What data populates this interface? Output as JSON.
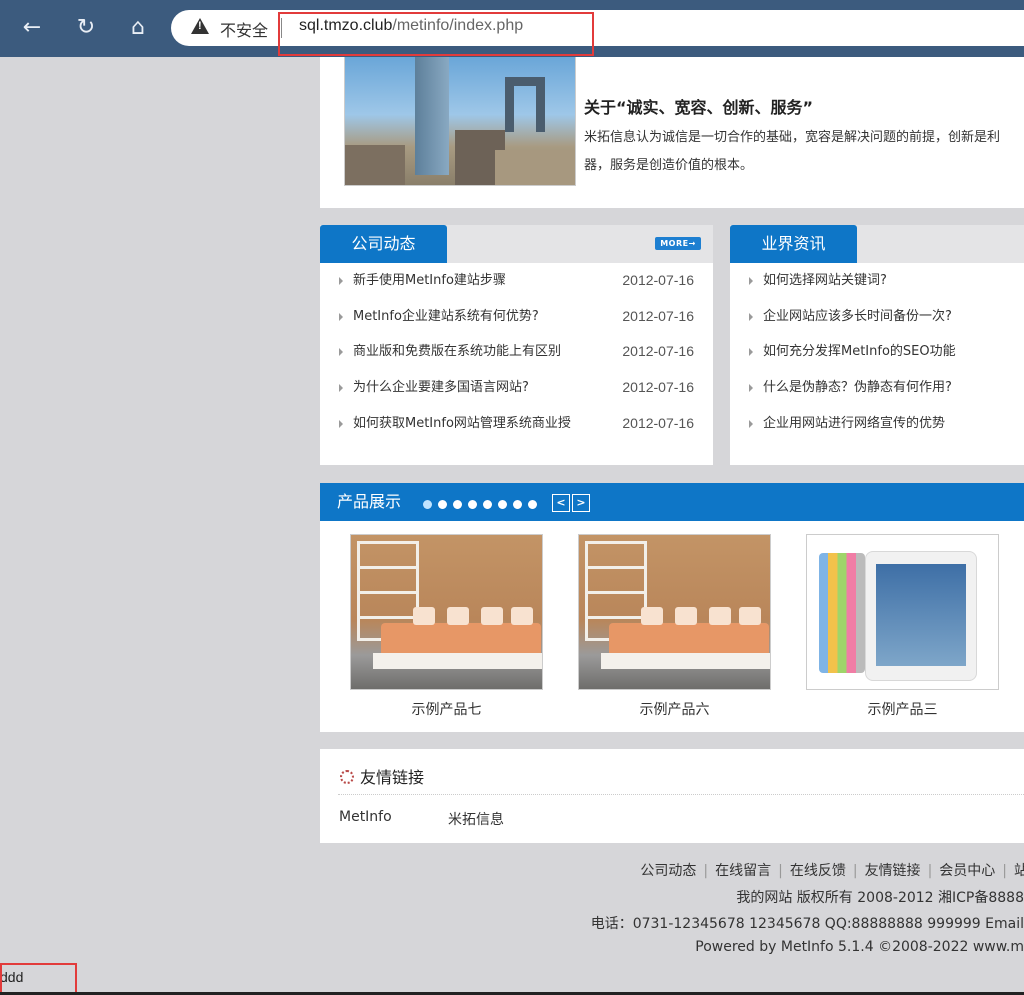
{
  "browser": {
    "back_icon": "←",
    "reload_icon": "↻",
    "home_icon": "⌂",
    "security_label": "不安全",
    "url_host": "sql.tmzo.club",
    "url_path": "/metinfo/index.php"
  },
  "about": {
    "title": "关于“诚实、宽容、创新、服务”",
    "text": "米拓信息认为诚信是一切合作的基础，宽容是解决问题的前提，创新是利器，服务是创造价值的根本。"
  },
  "company_news": {
    "tab_label": "公司动态",
    "more_label": "MORE→",
    "items": [
      {
        "title": "新手使用MetInfo建站步骤",
        "date": "2012-07-16"
      },
      {
        "title": "MetInfo企业建站系统有何优势?",
        "date": "2012-07-16"
      },
      {
        "title": "商业版和免费版在系统功能上有区别",
        "date": "2012-07-16"
      },
      {
        "title": "为什么企业要建多国语言网站?",
        "date": "2012-07-16"
      },
      {
        "title": "如何获取MetInfo网站管理系统商业授",
        "date": "2012-07-16"
      }
    ]
  },
  "industry_news": {
    "tab_label": "业界资讯",
    "items": [
      {
        "title": "如何选择网站关键词?"
      },
      {
        "title": "企业网站应该多长时间备份一次?"
      },
      {
        "title": "如何充分发挥MetInfo的SEO功能"
      },
      {
        "title": "什么是伪静态？伪静态有何作用?"
      },
      {
        "title": "企业用网站进行网络宣传的优势"
      }
    ]
  },
  "products": {
    "title": "产品展示",
    "prev_label": "<",
    "next_label": ">",
    "items": [
      {
        "label": "示例产品七"
      },
      {
        "label": "示例产品六"
      },
      {
        "label": "示例产品三"
      }
    ]
  },
  "friend_links": {
    "title": "友情链接",
    "links": [
      "MetInfo",
      "米拓信息"
    ]
  },
  "footer": {
    "nav": [
      "公司动态",
      "在线留言",
      "在线反馈",
      "友情链接",
      "会员中心",
      "站内搜索"
    ],
    "copyright": "我的网站 版权所有 2008-2012 湘ICP备8888",
    "contact": "电话：0731-12345678 12345678 QQ:88888888 999999 Email",
    "powered": "Powered by MetInfo 5.1.4 ©2008-2022  www.m"
  },
  "status_text": "ddd"
}
